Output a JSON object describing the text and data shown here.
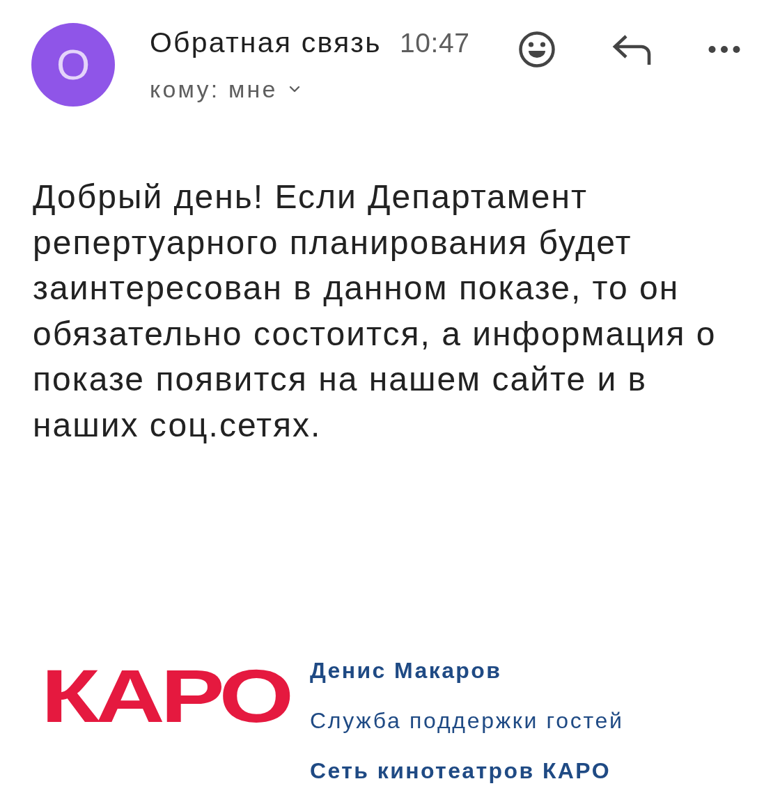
{
  "message": {
    "avatar_letter": "О",
    "sender": "Обратная связь",
    "time": "10:47",
    "recipient": "кому: мне",
    "body": "Добрый день! Если Департамент репертуарного планирования будет заинтересован в данном показе, то он обязательно состоится, а информация о показе появится на нашем сайте и в наших соц.сетях."
  },
  "signature": {
    "logo": "КАРО",
    "name": "Денис Макаров",
    "role": "Служба поддержки гостей",
    "company": "Сеть кинотеатров КАРО"
  }
}
